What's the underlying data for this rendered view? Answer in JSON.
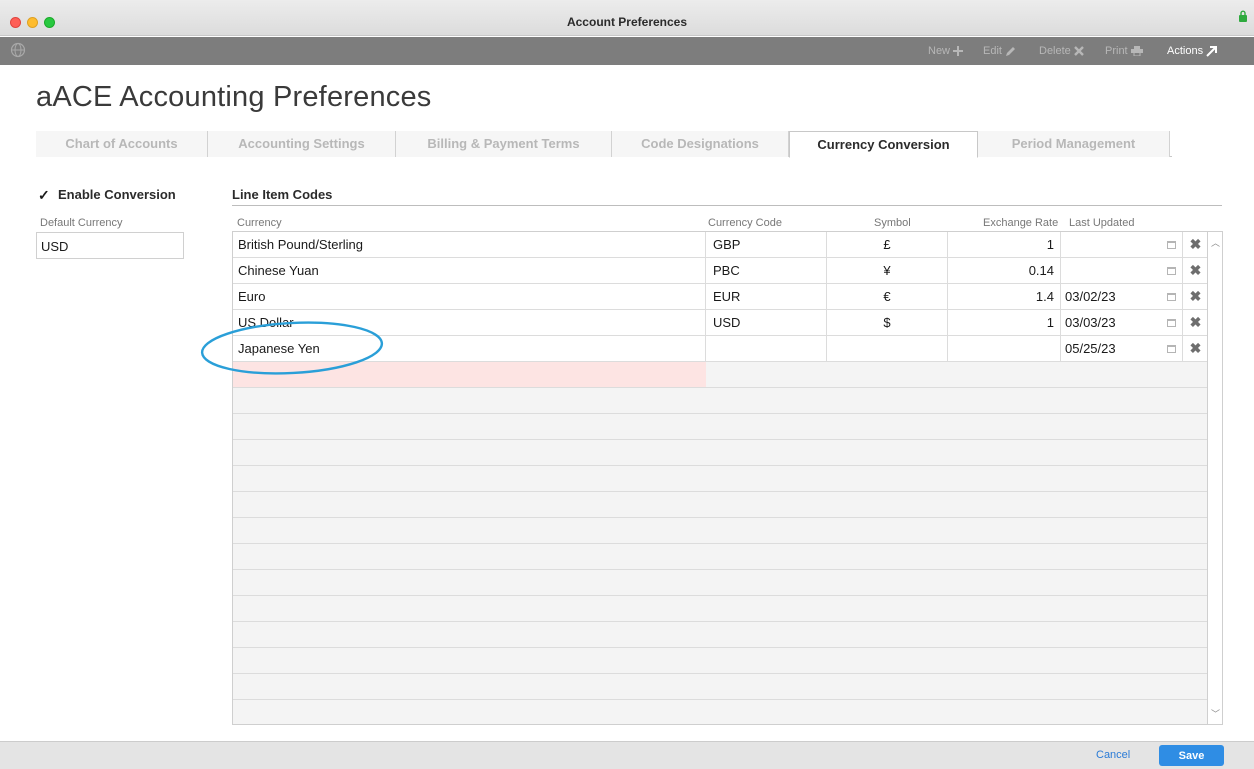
{
  "window": {
    "title": "Account Preferences"
  },
  "toolbar": {
    "new_label": "New",
    "edit_label": "Edit",
    "delete_label": "Delete",
    "print_label": "Print",
    "actions_label": "Actions"
  },
  "page": {
    "title": "aACE Accounting Preferences"
  },
  "tabs": [
    {
      "label": "Chart of Accounts"
    },
    {
      "label": "Accounting Settings"
    },
    {
      "label": "Billing & Payment Terms"
    },
    {
      "label": "Code Designations"
    },
    {
      "label": "Currency Conversion",
      "active": true
    },
    {
      "label": "Period Management"
    }
  ],
  "conversion": {
    "enable_label": "Enable Conversion",
    "enabled": true,
    "default_currency_label": "Default Currency",
    "default_currency_value": "USD"
  },
  "line_items": {
    "title": "Line Item Codes",
    "columns": {
      "currency": "Currency",
      "code": "Currency Code",
      "symbol": "Symbol",
      "rate": "Exchange Rate",
      "updated": "Last Updated"
    },
    "rows": [
      {
        "currency": "British Pound/Sterling",
        "code": "GBP",
        "symbol": "£",
        "rate": "1",
        "updated": ""
      },
      {
        "currency": "Chinese Yuan",
        "code": "PBC",
        "symbol": "¥",
        "rate": "0.14",
        "updated": ""
      },
      {
        "currency": "Euro",
        "code": "EUR",
        "symbol": "€",
        "rate": "1.4",
        "updated": "03/02/23"
      },
      {
        "currency": "US Dollar",
        "code": "USD",
        "symbol": "$",
        "rate": "1",
        "updated": "03/03/23"
      },
      {
        "currency": "Japanese Yen",
        "code": "",
        "symbol": "",
        "rate": "",
        "updated": "05/25/23"
      }
    ]
  },
  "footer": {
    "cancel_label": "Cancel",
    "save_label": "Save"
  },
  "colors": {
    "accent": "#2f8de4",
    "toolbar": "#7d7d7d",
    "annotation": "#2a9fd8",
    "new_row_highlight": "#fde4e3"
  }
}
